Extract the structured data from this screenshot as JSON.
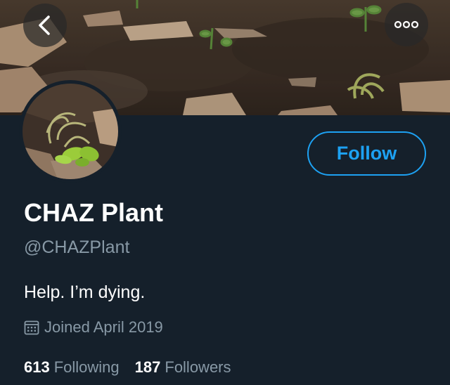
{
  "header": {
    "back_icon": "chevron-left-icon",
    "more_icon": "more-horizontal-icon"
  },
  "profile": {
    "display_name": "CHAZ Plant",
    "handle": "@CHAZPlant",
    "bio": "Help. I’m dying.",
    "joined_icon": "calendar-icon",
    "joined": "Joined April 2019",
    "follow_label": "Follow"
  },
  "stats": {
    "following_count": "613",
    "following_label": "Following",
    "followers_count": "187",
    "followers_label": "Followers"
  },
  "colors": {
    "background": "#15202b",
    "accent": "#1da1f2",
    "secondary_text": "#8899a6",
    "primary_text": "#ffffff"
  }
}
